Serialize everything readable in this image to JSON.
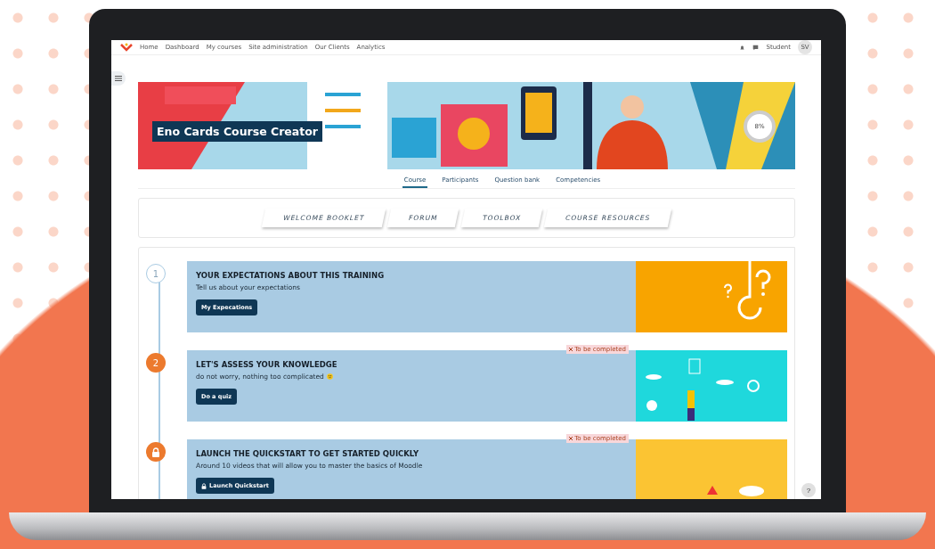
{
  "navbar": {
    "items": [
      "Home",
      "Dashboard",
      "My courses",
      "Site administration",
      "Our Clients",
      "Analytics"
    ],
    "user": "Student",
    "avatar": "SV"
  },
  "banner": {
    "title": "Eno Cards Course Creator",
    "progress": "8%"
  },
  "tabs": [
    {
      "label": "Course",
      "selected": true
    },
    {
      "label": "Participants",
      "selected": false
    },
    {
      "label": "Question bank",
      "selected": false
    },
    {
      "label": "Competencies",
      "selected": false
    }
  ],
  "quick_links": [
    "WELCOME BOOKLET",
    "FORUM",
    "TOOLBOX",
    "COURSE RESOURCES"
  ],
  "sections": [
    {
      "marker": {
        "kind": "number",
        "label": "1",
        "filled": false
      },
      "title": "YOUR EXPECTATIONS ABOUT THIS TRAINING",
      "description": "Tell us about your expectations",
      "emoji": false,
      "button": {
        "label": "My Expecations",
        "locked": false
      }
    },
    {
      "marker": {
        "kind": "number",
        "label": "2",
        "filled": true
      },
      "title": "LET'S ASSESS YOUR KNOWLEDGE",
      "description": "do not worry, nothing too complicated",
      "emoji": true,
      "status": "To be completed",
      "button": {
        "label": "Do a quiz",
        "locked": false
      }
    },
    {
      "marker": {
        "kind": "lock",
        "filled": true
      },
      "title": "LAUNCH THE QUICKSTART TO GET STARTED QUICKLY",
      "description": "Around 10 videos that will allow you to master the basics of Moodle",
      "emoji": false,
      "status": "To be completed",
      "button": {
        "label": "Launch Quickstart",
        "locked": true
      }
    }
  ],
  "help": "?"
}
